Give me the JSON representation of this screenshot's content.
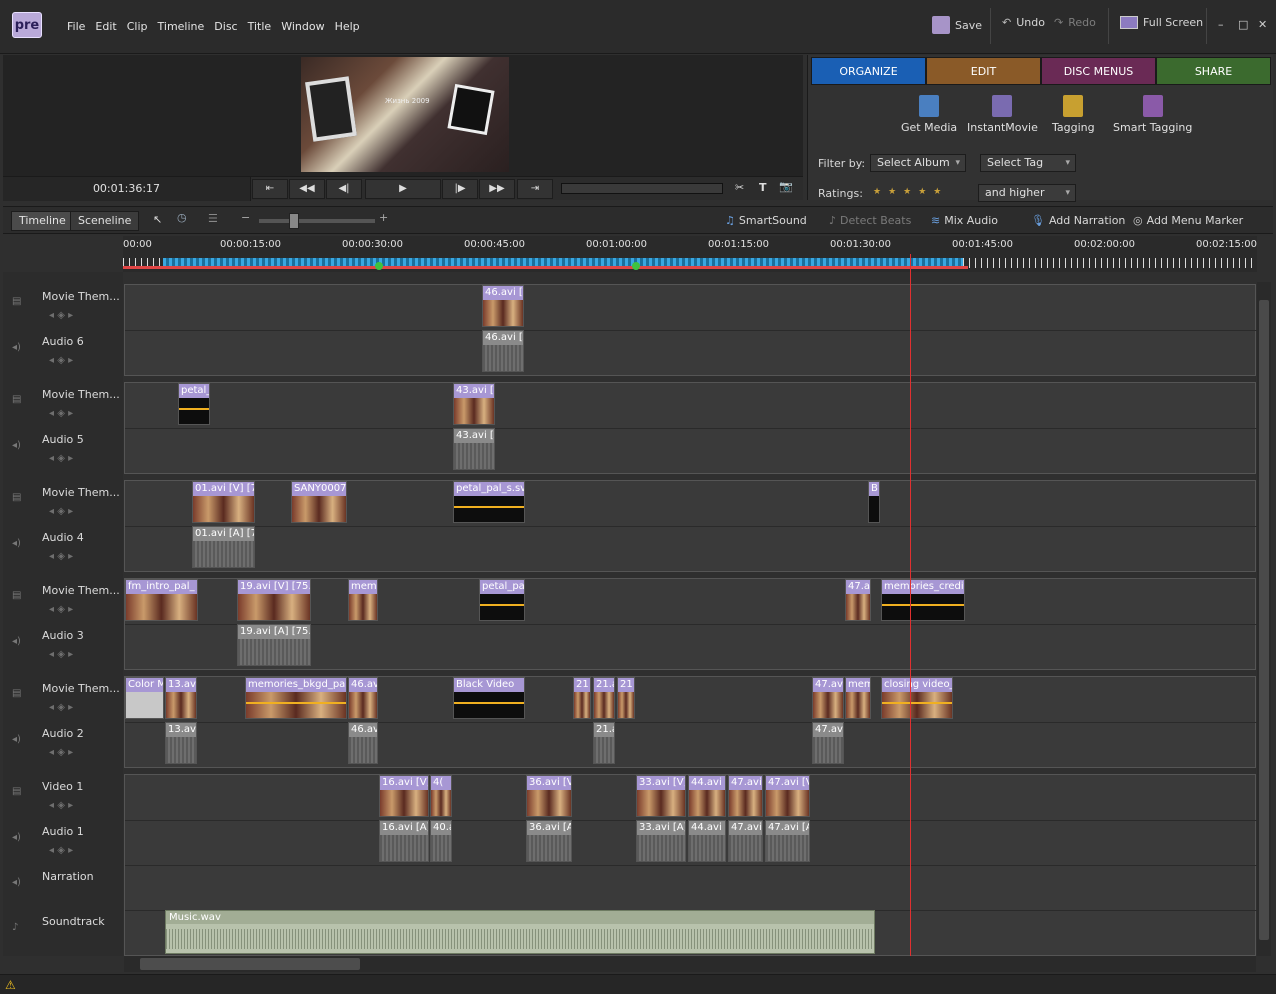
{
  "app": {
    "logo": "pre"
  },
  "menu": [
    "File",
    "Edit",
    "Clip",
    "Timeline",
    "Disc",
    "Title",
    "Window",
    "Help"
  ],
  "toolbar": {
    "save": "Save",
    "undo": "Undo",
    "redo": "Redo",
    "fullscreen": "Full Screen",
    "min": "–",
    "max": "□",
    "close": "✕"
  },
  "monitor": {
    "timecode": "00:01:36:17",
    "caption": "Жизнь 2009",
    "btns": [
      "⇤",
      "◀◀",
      "◀|",
      "▶",
      "|▶",
      "▶▶",
      "⇥"
    ],
    "tools": [
      "✂",
      "T",
      "📷"
    ]
  },
  "tabs": [
    {
      "label": "ORGANIZE",
      "color": "#1a5fb4"
    },
    {
      "label": "EDIT",
      "color": "#8a5a28"
    },
    {
      "label": "DISC MENUS",
      "color": "#6a2a55"
    },
    {
      "label": "SHARE",
      "color": "#3b6a2e"
    }
  ],
  "organize": {
    "tools": [
      "Get Media",
      "InstantMovie",
      "Tagging",
      "Smart Tagging"
    ],
    "filter_label": "Filter by:",
    "album": "Select Album",
    "tag": "Select Tag",
    "ratings_label": "Ratings:",
    "stars": "★★★★★",
    "higher": "and higher"
  },
  "timeline_bar": {
    "timeline": "Timeline",
    "sceneline": "Sceneline",
    "zoom_minus": "−",
    "zoom_plus": "+",
    "smartsound": "SmartSound",
    "detect": "Detect Beats",
    "mix": "Mix Audio",
    "narration": "Add Narration",
    "menumarker": "Add Menu Marker"
  },
  "ruler": [
    "00:00",
    "00:00:15:00",
    "00:00:30:00",
    "00:00:45:00",
    "00:01:00:00",
    "00:01:15:00",
    "00:01:30:00",
    "00:01:45:00",
    "00:02:00:00",
    "00:02:15:00"
  ],
  "tracks": [
    "Movie Them...",
    "Audio 6",
    "Movie Them...",
    "Audio 5",
    "Movie Them...",
    "Audio 4",
    "Movie Them...",
    "Audio 3",
    "Movie Them...",
    "Audio 2",
    "Video 1",
    "Audio 1",
    "Narration",
    "Soundtrack"
  ],
  "clips": {
    "t6v": [
      "46.avi [V"
    ],
    "t6a": [
      "46.avi [A"
    ],
    "t5v": [
      "petal_",
      "43.avi [V"
    ],
    "t5a": [
      "43.avi [A"
    ],
    "t4v": [
      "01.avi [V] [72",
      "SANY0007",
      "petal_pal_s.sv",
      "B"
    ],
    "t4a": [
      "01.avi [A] [72"
    ],
    "t3v": [
      "fm_intro_pal_",
      "19.avi [V] [75.8",
      "memo",
      "petal_pa",
      "47.av",
      "memories_credit"
    ],
    "t3a": [
      "19.avi [A] [75.8"
    ],
    "t2v": [
      "Color M",
      "13.avi",
      "memories_bkgd_pal",
      "46.av",
      "Black Video",
      "21",
      "21.a",
      "21",
      "47.avi",
      "mem",
      "closing video_"
    ],
    "t2a": [
      "13.avi",
      "46.av",
      "21.a",
      "47.avi"
    ],
    "t1v": [
      "16.avi [V]",
      "4(",
      "36.avi [V]",
      "33.avi [V]",
      "44.avi",
      "47.avi",
      "47.avi [V"
    ],
    "t1a": [
      "16.avi [A]",
      "40.a",
      "36.avi [A]",
      "33.avi [A]",
      "44.avi [",
      "47.avi",
      "47.avi [A"
    ],
    "music": "Music.wav"
  },
  "status": {
    "warn": "⚠"
  }
}
